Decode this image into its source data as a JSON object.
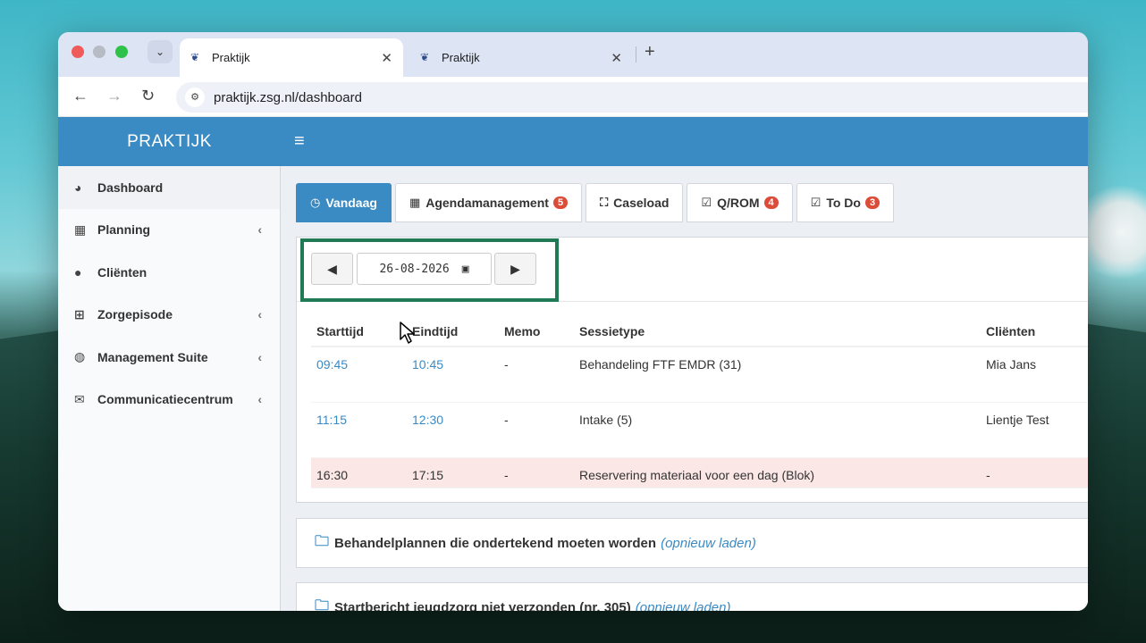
{
  "browser": {
    "tabs": [
      {
        "title": "Praktijk",
        "close": "✕"
      },
      {
        "title": "Praktijk",
        "close": "✕"
      }
    ],
    "new_tab": "+",
    "url": "praktijk.zsg.nl/dashboard"
  },
  "app": {
    "brand": "PRAKTIJK",
    "menu_icon": "≡"
  },
  "sidebar": {
    "items": [
      {
        "label": "Dashboard",
        "icon": "dashboard-icon"
      },
      {
        "label": "Planning",
        "icon": "calendar-icon"
      },
      {
        "label": "Cliënten",
        "icon": "user-icon"
      },
      {
        "label": "Zorgepisode",
        "icon": "medkit-icon"
      },
      {
        "label": "Management Suite",
        "icon": "globe-icon"
      },
      {
        "label": "Communicatiecentrum",
        "icon": "envelope-icon"
      }
    ]
  },
  "tabs": [
    {
      "label": "Vandaag",
      "badge": ""
    },
    {
      "label": "Agendamanagement",
      "badge": "5"
    },
    {
      "label": "Caseload",
      "badge": ""
    },
    {
      "label": "Q/ROM",
      "badge": "4"
    },
    {
      "label": "To Do",
      "badge": "3"
    }
  ],
  "date_picker": {
    "value": "26-08-2026"
  },
  "schedule": {
    "headers": [
      "Starttijd",
      "Eindtijd",
      "Memo",
      "Sessietype",
      "Cliënten"
    ],
    "rows": [
      {
        "start": "09:45",
        "end": "10:45",
        "memo": "-",
        "type": "Behandeling FTF EMDR (31)",
        "client": "Mia Jans"
      },
      {
        "start": "11:15",
        "end": "12:30",
        "memo": "-",
        "type": "Intake (5)",
        "client": "Lientje Test"
      },
      {
        "start": "16:30",
        "end": "17:15",
        "memo": "-",
        "type": "Reservering materiaal voor een dag (Blok)",
        "client": "-"
      }
    ]
  },
  "panels": {
    "plans_title": "Behandelplannen die ondertekend moeten worden",
    "plans_reload": "(opnieuw laden)",
    "start_title": "Startbericht jeugdzorg niet verzonden (nr. 305)",
    "start_reload": "(opnieuw laden)"
  },
  "colors": {
    "header_blue": "#3a8ac4",
    "highlight_green": "#1f7a55",
    "badge_red": "#dd4b39",
    "blocked_row": "#fbe7e6"
  }
}
